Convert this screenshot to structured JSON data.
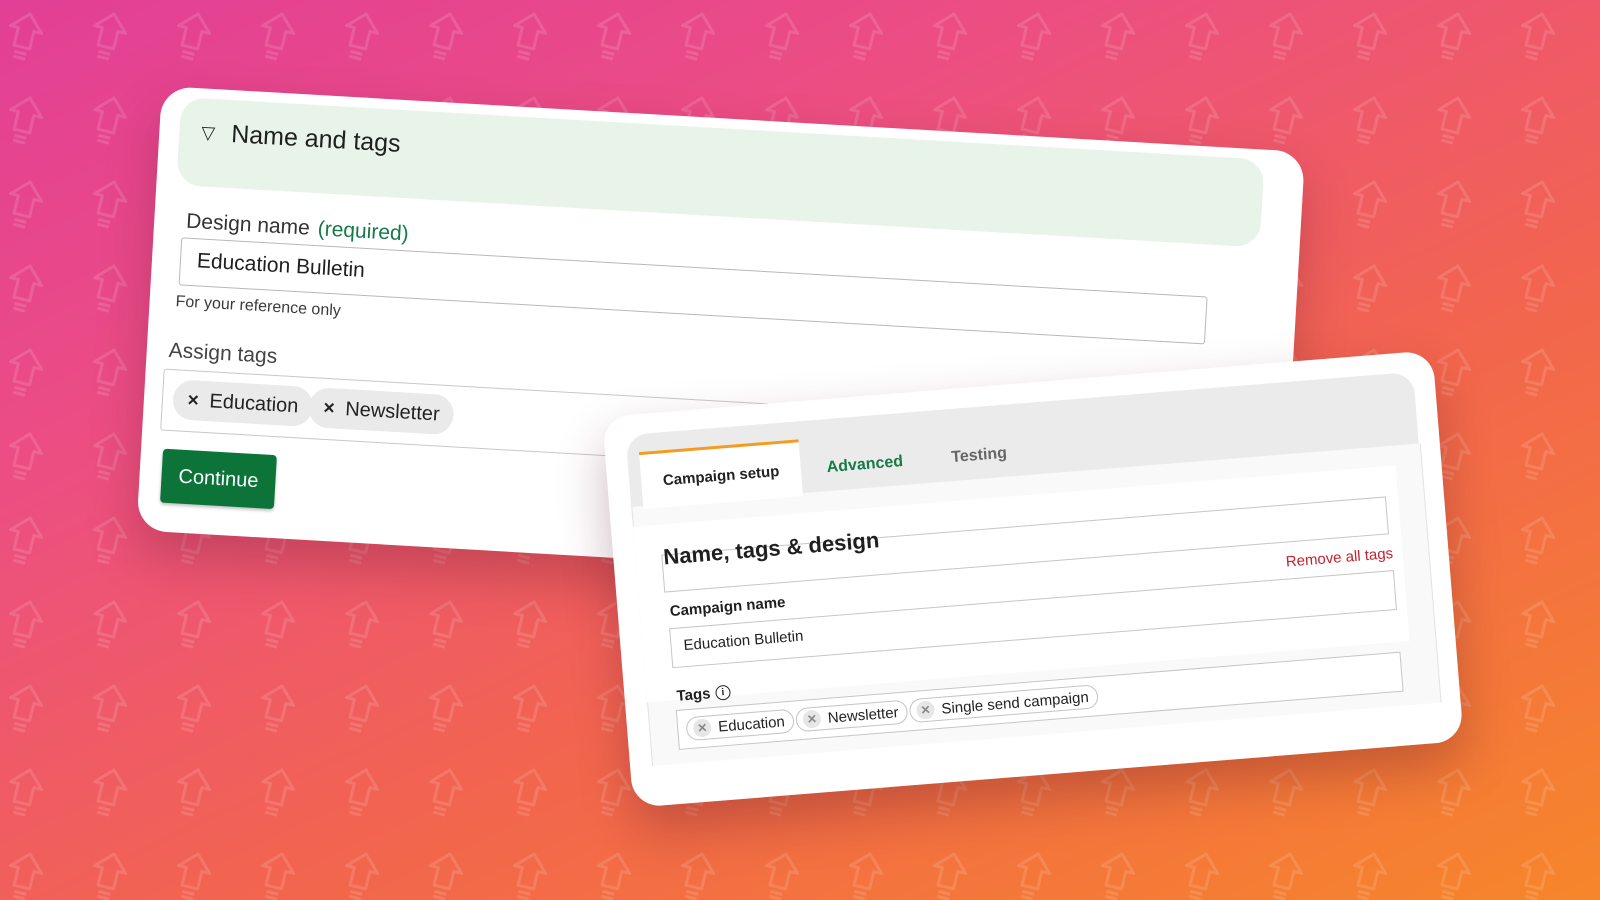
{
  "design_card": {
    "section_title": "Name and tags",
    "design_name_label": "Design name",
    "required_label": "(required)",
    "design_name_value": "Education Bulletin",
    "helper_text": "For your reference only",
    "assign_tags_label": "Assign tags",
    "tags": [
      "Education",
      "Newsletter"
    ],
    "continue_label": "Continue"
  },
  "campaign_card": {
    "tabs": [
      "Campaign setup",
      "Advanced",
      "Testing"
    ],
    "active_tab": "Campaign setup",
    "section_heading": "Name, tags & design",
    "campaign_name_label": "Campaign name",
    "remove_all_tags_label": "Remove all tags",
    "campaign_name_value": "Education Bulletin",
    "tags_label": "Tags",
    "tags": [
      "Education",
      "Newsletter",
      "Single send campaign"
    ]
  },
  "colors": {
    "background_start": "#e23f96",
    "background_end": "#f6862a",
    "primary_button": "#0c7439",
    "required_text": "#157a47",
    "active_tab_accent": "#f49b22",
    "remove_link": "#c4222d",
    "header_band": "#e8f4e9"
  },
  "icons": {
    "background_pattern": "upload-arrow-icon",
    "section_toggle": "triangle-down-icon",
    "tag_remove": "close-icon",
    "tags_info": "info-icon"
  }
}
